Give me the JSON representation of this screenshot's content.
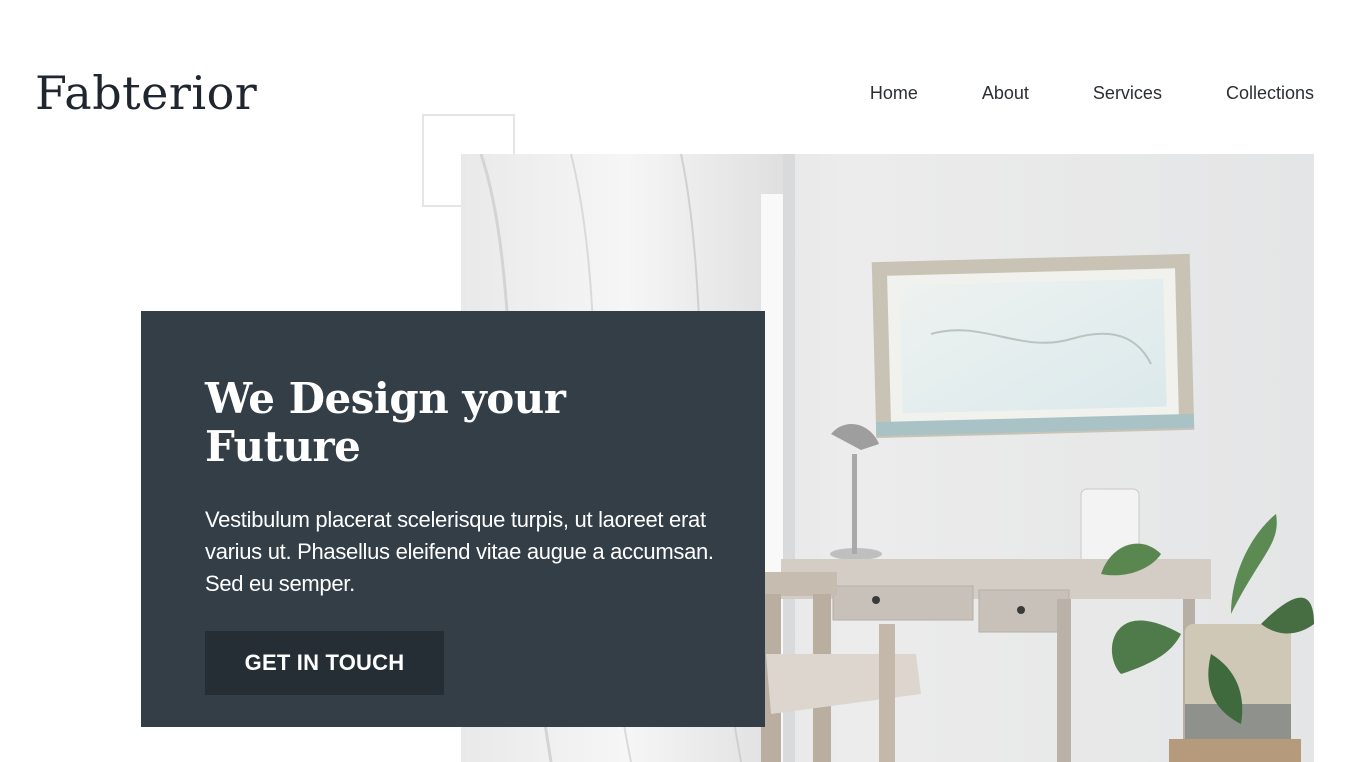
{
  "header": {
    "logo": "Fabterior",
    "nav": [
      {
        "label": "Home"
      },
      {
        "label": "About"
      },
      {
        "label": "Services"
      },
      {
        "label": "Collections"
      }
    ]
  },
  "hero": {
    "title": "We Design your Future",
    "text": "Vestibulum placerat scelerisque turpis, ut laoreet erat varius ut. Phasellus eleifend vitae augue a accumsan. Sed eu semper.",
    "cta_label": "GET IN TOUCH"
  },
  "colors": {
    "card_bg": "#333e47",
    "button_bg": "#252e35",
    "text_dark": "#1f2630"
  }
}
